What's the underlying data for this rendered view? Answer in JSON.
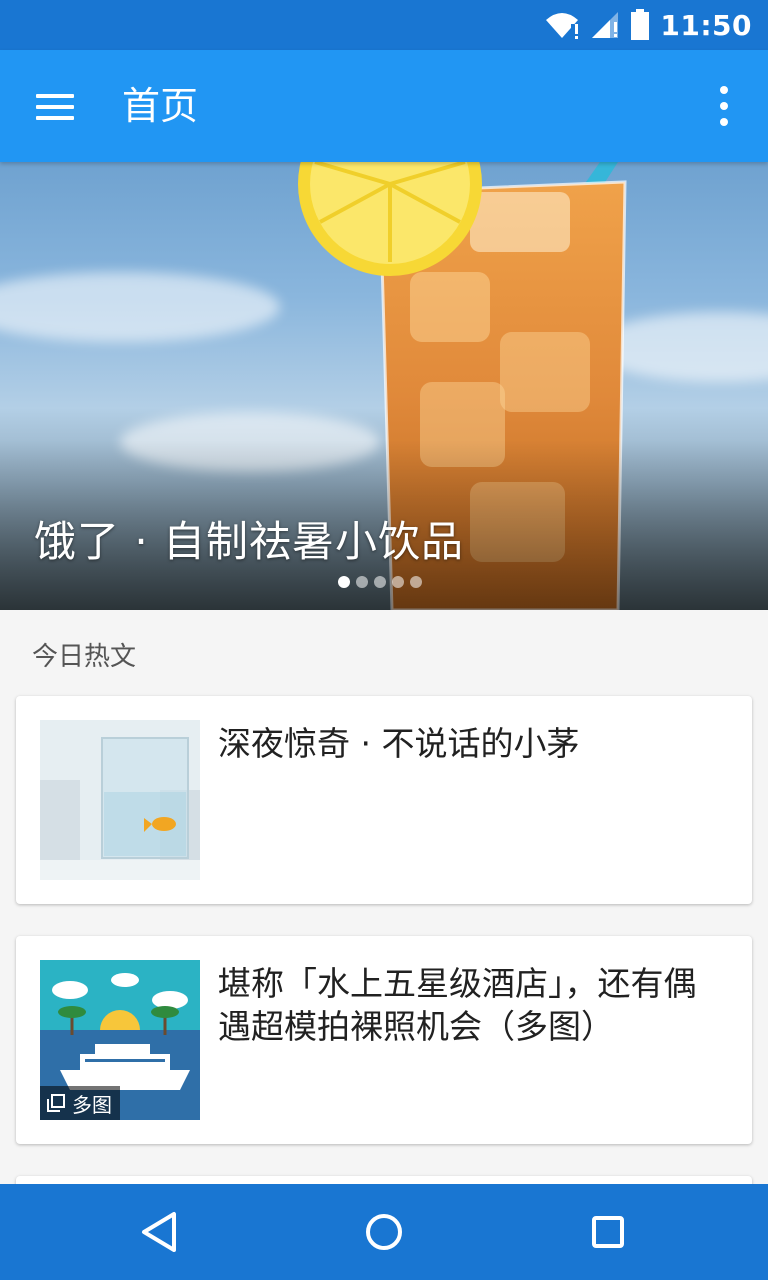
{
  "status_bar": {
    "time": "11:50"
  },
  "app_bar": {
    "title": "首页"
  },
  "hero": {
    "title": "饿了 · 自制祛暑小饮品",
    "slide_count": 5,
    "active_slide": 1
  },
  "section": {
    "title": "今日热文"
  },
  "articles": [
    {
      "title": "深夜惊奇 · 不说话的小茅"
    },
    {
      "title": "堪称「水上五星级酒店」，还有偶遇超模拍裸照机会（多图）",
      "badge": "多图"
    }
  ],
  "colors": {
    "primary": "#2196F3",
    "primary_dark": "#1976D2"
  }
}
